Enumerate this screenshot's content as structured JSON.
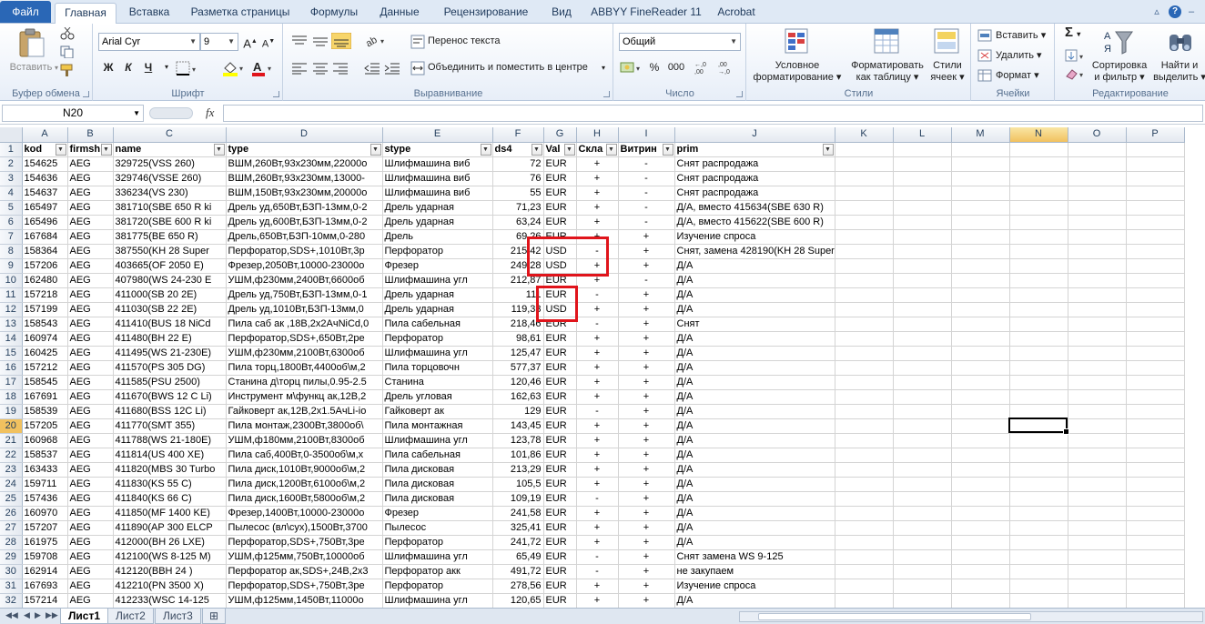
{
  "tabs": {
    "file": "Файл",
    "items": [
      "Главная",
      "Вставка",
      "Разметка страницы",
      "Формулы",
      "Данные",
      "Рецензирование",
      "Вид",
      "ABBYY FineReader 11",
      "Acrobat"
    ]
  },
  "ribbon": {
    "clipboard": {
      "paste": "Вставить",
      "label": "Буфер обмена"
    },
    "font": {
      "name": "Arial Cyr",
      "size": "9",
      "label": "Шрифт",
      "bold": "Ж",
      "italic": "К",
      "underline": "Ч"
    },
    "alignment": {
      "wrap": "Перенос текста",
      "merge": "Объединить и поместить в центре",
      "label": "Выравнивание"
    },
    "number": {
      "format": "Общий",
      "percent": "%",
      "thousands": "000",
      "label": "Число"
    },
    "styles": {
      "conditional_1": "Условное",
      "conditional_2": "форматирование",
      "table_1": "Форматировать",
      "table_2": "как таблицу",
      "cell_1": "Стили",
      "cell_2": "ячеек",
      "label": "Стили"
    },
    "cells": {
      "insert": "Вставить",
      "delete": "Удалить",
      "format": "Формат",
      "label": "Ячейки"
    },
    "editing": {
      "sum": "Σ",
      "sort_1": "Сортировка",
      "sort_2": "и фильтр",
      "find_1": "Найти и",
      "find_2": "выделить",
      "label": "Редактирование"
    }
  },
  "formula_bar": {
    "name_box": "N20",
    "fx": "fx",
    "content": ""
  },
  "columns": [
    "A",
    "B",
    "C",
    "D",
    "E",
    "F",
    "G",
    "H",
    "I",
    "J",
    "K",
    "L",
    "M",
    "N",
    "O",
    "P"
  ],
  "header_row": [
    "kod",
    "firmsh",
    "name",
    "type",
    "stype",
    "ds4",
    "Val",
    "Скла",
    "Витрин",
    "prim"
  ],
  "rows": [
    [
      "154625",
      "AEG",
      "329725(VSS 260)",
      "ВШМ,260Вт,93х230мм,22000о",
      "Шлифмашина виб",
      "72",
      "EUR",
      "+",
      "-",
      "Снят распродажа"
    ],
    [
      "154636",
      "AEG",
      "329746(VSSE 260)",
      "ВШМ,260Вт,93х230мм,13000-",
      "Шлифмашина виб",
      "76",
      "EUR",
      "+",
      "-",
      "Снят распродажа"
    ],
    [
      "154637",
      "AEG",
      "336234(VS 230)",
      "ВШМ,150Вт,93х230мм,20000о",
      "Шлифмашина виб",
      "55",
      "EUR",
      "+",
      "-",
      "Снят распродажа"
    ],
    [
      "165497",
      "AEG",
      "381710(SBE 650 R ki",
      "Дрель уд,650Вт,БЗП-13мм,0-2",
      "Дрель ударная",
      "71,23",
      "EUR",
      "+",
      "-",
      "Д/А, вместо 415634(SBE 630 R)"
    ],
    [
      "165496",
      "AEG",
      "381720(SBE 600 R ki",
      "Дрель уд,600Вт,БЗП-13мм,0-2",
      "Дрель ударная",
      "63,24",
      "EUR",
      "+",
      "-",
      "Д/А, вместо 415622(SBE 600 R)"
    ],
    [
      "167684",
      "AEG",
      "381775(BE 650 R)",
      "Дрель,650Вт,БЗП-10мм,0-280",
      "Дрель",
      "69,26",
      "EUR",
      "+",
      "+",
      "Изучение спроса"
    ],
    [
      "158364",
      "AEG",
      "387550(KH 28 Super",
      "Перфоратор,SDS+,1010Вт,3р",
      "Перфоратор",
      "215,42",
      "USD",
      "-",
      "+",
      "Снят, замена 428190(KH 28 Super XE)"
    ],
    [
      "157206",
      "AEG",
      "403665(OF 2050 E)",
      "Фрезер,2050Вт,10000-23000о",
      "Фрезер",
      "249,28",
      "USD",
      "+",
      "+",
      "Д/А"
    ],
    [
      "162480",
      "AEG",
      "407980(WS 24-230 E",
      "УШМ,ф230мм,2400Вт,6600об",
      "Шлифмашина угл",
      "212,87",
      "EUR",
      "+",
      "-",
      "Д/А"
    ],
    [
      "157218",
      "AEG",
      "411000(SB 20 2E)",
      "Дрель уд,750Вт,БЗП-13мм,0-1",
      "Дрель ударная",
      "111",
      "EUR",
      "-",
      "+",
      "Д/А"
    ],
    [
      "157199",
      "AEG",
      "411030(SB 22 2E)",
      "Дрель уд,1010Вт,БЗП-13мм,0",
      "Дрель ударная",
      "119,33",
      "USD",
      "+",
      "+",
      "Д/А"
    ],
    [
      "158543",
      "AEG",
      "411410(BUS 18 NiCd",
      "Пила саб ак ,18В,2х2АчNiCd,0",
      "Пила сабельная",
      "218,46",
      "EUR",
      "-",
      "+",
      "Снят"
    ],
    [
      "160974",
      "AEG",
      "411480(BH 22 E)",
      "Перфоратор,SDS+,650Вт,2ре",
      "Перфоратор",
      "98,61",
      "EUR",
      "+",
      "+",
      "Д/А"
    ],
    [
      "160425",
      "AEG",
      "411495(WS 21-230E)",
      "УШМ,ф230мм,2100Вт,6300об",
      "Шлифмашина угл",
      "125,47",
      "EUR",
      "+",
      "+",
      "Д/А"
    ],
    [
      "157212",
      "AEG",
      "411570(PS 305 DG)",
      "Пила торц,1800Вт,4400об\\м,2",
      "Пила торцовочн",
      "577,37",
      "EUR",
      "+",
      "+",
      "Д/А"
    ],
    [
      "158545",
      "AEG",
      "411585(PSU 2500)",
      "Станина д\\торц пилы,0.95-2.5",
      "Станина",
      "120,46",
      "EUR",
      "+",
      "+",
      "Д/А"
    ],
    [
      "167691",
      "AEG",
      "411670(BWS 12 C Li)",
      "Инструмент м\\функц ак,12В,2",
      "Дрель угловая",
      "162,63",
      "EUR",
      "+",
      "+",
      "Д/А"
    ],
    [
      "158539",
      "AEG",
      "411680(BSS 12C Li)",
      "Гайковерт ак,12В,2х1.5АчLi-io",
      "Гайковерт ак",
      "129",
      "EUR",
      "-",
      "+",
      "Д/А"
    ],
    [
      "157205",
      "AEG",
      "411770(SMT 355)",
      "Пила монтаж,2300Вт,3800об\\",
      "Пила монтажная",
      "143,45",
      "EUR",
      "+",
      "+",
      "Д/А"
    ],
    [
      "160968",
      "AEG",
      "411788(WS 21-180E)",
      "УШМ,ф180мм,2100Вт,8300об",
      "Шлифмашина угл",
      "123,78",
      "EUR",
      "+",
      "+",
      "Д/А"
    ],
    [
      "158537",
      "AEG",
      "411814(US 400 XE)",
      "Пила саб,400Вт,0-3500об\\м,х",
      "Пила сабельная",
      "101,86",
      "EUR",
      "+",
      "+",
      "Д/А"
    ],
    [
      "163433",
      "AEG",
      "411820(MBS 30 Turbo",
      "Пила диск,1010Вт,9000об\\м,2",
      "Пила дисковая",
      "213,29",
      "EUR",
      "+",
      "+",
      "Д/А"
    ],
    [
      "159711",
      "AEG",
      "411830(KS 55 C)",
      "Пила диск,1200Вт,6100об\\м,2",
      "Пила дисковая",
      "105,5",
      "EUR",
      "+",
      "+",
      "Д/А"
    ],
    [
      "157436",
      "AEG",
      "411840(KS 66 C)",
      "Пила диск,1600Вт,5800об\\м,2",
      "Пила дисковая",
      "109,19",
      "EUR",
      "-",
      "+",
      "Д/А"
    ],
    [
      "160970",
      "AEG",
      "411850(MF 1400 KE)",
      "Фрезер,1400Вт,10000-23000о",
      "Фрезер",
      "241,58",
      "EUR",
      "+",
      "+",
      "Д/А"
    ],
    [
      "157207",
      "AEG",
      "411890(AP 300 ELCP",
      "Пылесос (вл\\сух),1500Вт,3700",
      "Пылесос",
      "325,41",
      "EUR",
      "+",
      "+",
      "Д/А"
    ],
    [
      "161975",
      "AEG",
      "412000(BH 26 LXE)",
      "Перфоратор,SDS+,750Вт,3ре",
      "Перфоратор",
      "241,72",
      "EUR",
      "+",
      "+",
      "Д/А"
    ],
    [
      "159708",
      "AEG",
      "412100(WS 8-125 M)",
      "УШМ,ф125мм,750Вт,10000об",
      "Шлифмашина угл",
      "65,49",
      "EUR",
      "-",
      "+",
      "Снят замена WS 9-125"
    ],
    [
      "162914",
      "AEG",
      "412120(BBH 24 )",
      "Перфоратор ак,SDS+,24В,2х3",
      "Перфоратор акк",
      "491,72",
      "EUR",
      "-",
      "+",
      "не закупаем"
    ],
    [
      "167693",
      "AEG",
      "412210(PN 3500 X)",
      "Перфоратор,SDS+,750Вт,3ре",
      "Перфоратор",
      "278,56",
      "EUR",
      "+",
      "+",
      "Изучение спроса"
    ],
    [
      "157214",
      "AEG",
      "412233(WSC 14-125",
      "УШМ,ф125мм,1450Вт,11000о",
      "Шлифмашина угл",
      "120,65",
      "EUR",
      "+",
      "+",
      "Д/А"
    ]
  ],
  "sheets": [
    "Лист1",
    "Лист2",
    "Лист3"
  ],
  "selected_cell": "N20",
  "accent": {
    "selection": "#f1c15f",
    "highlight_box": "#e0141b",
    "file_tab": "#2a67b6"
  }
}
